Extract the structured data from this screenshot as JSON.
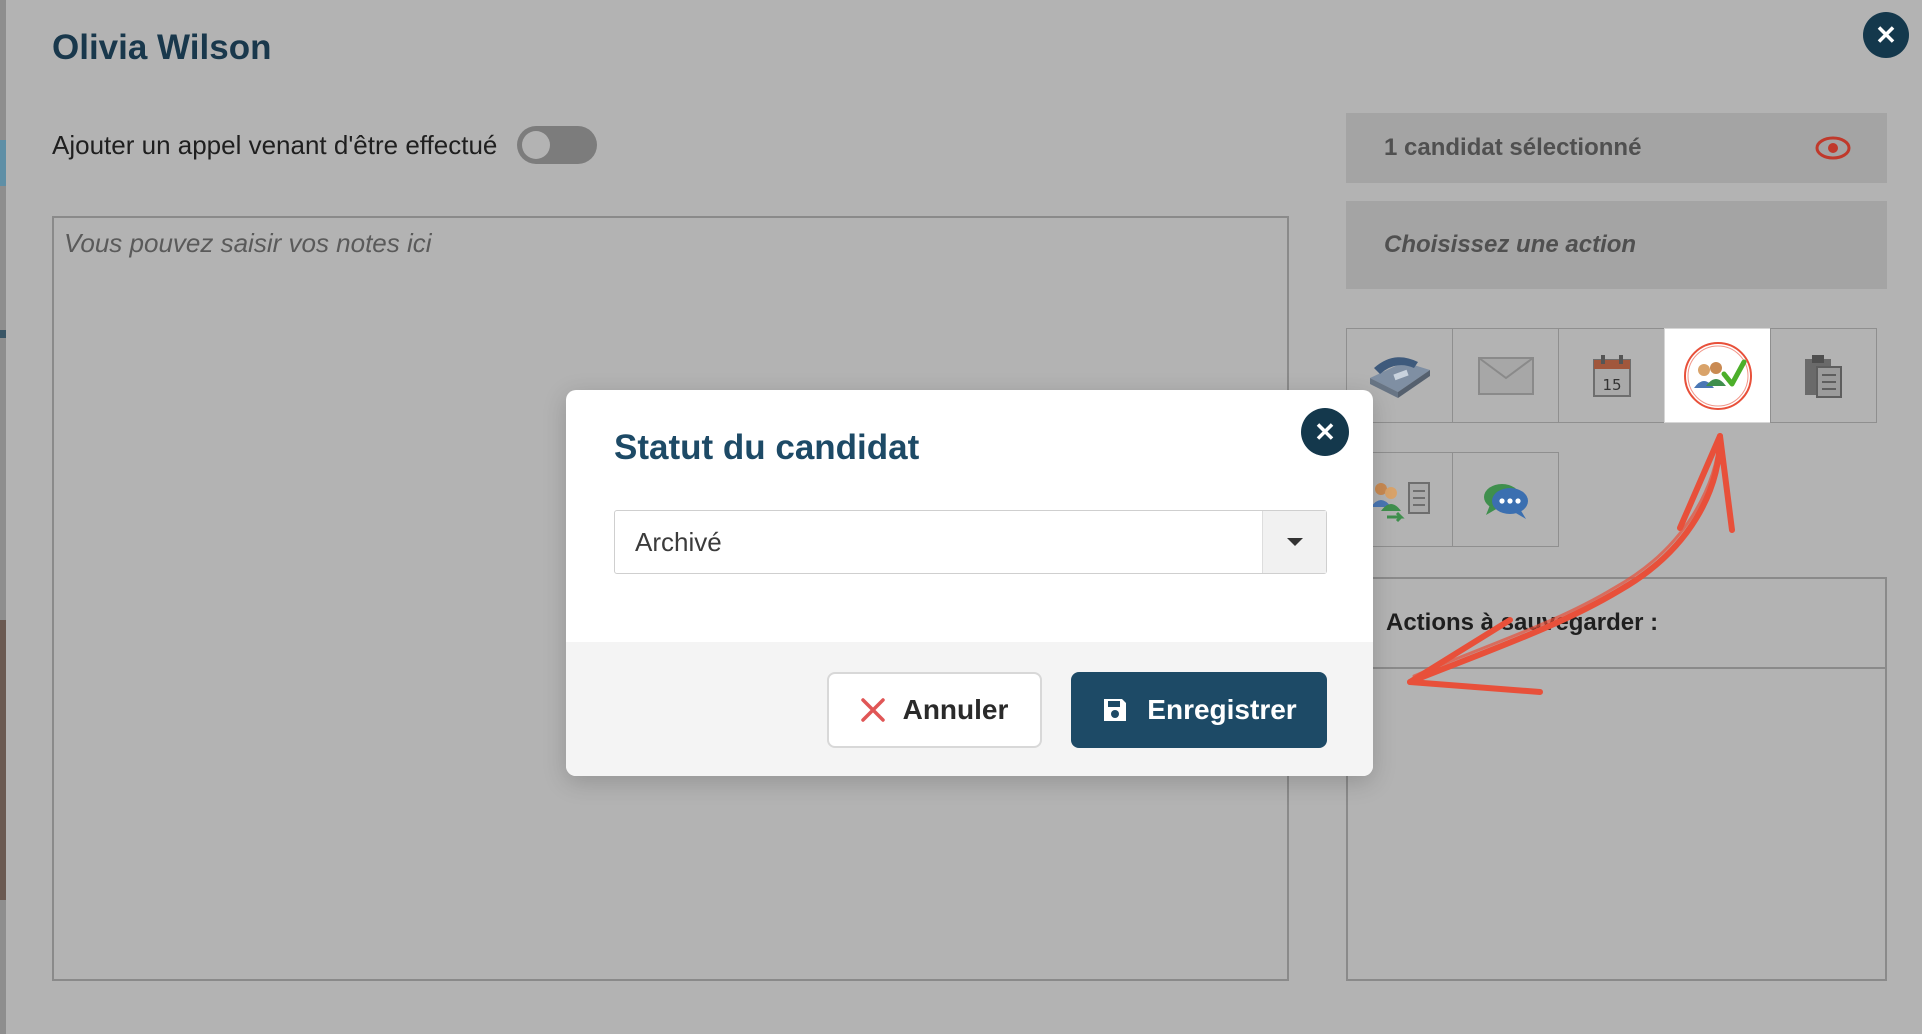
{
  "panel": {
    "title": "Olivia Wilson",
    "close_icon": "close-icon",
    "call_toggle_label": "Ajouter un appel venant d'être effectué",
    "call_toggle_on": false,
    "notes_placeholder": "Vous pouvez saisir vos notes ici",
    "notes_value": ""
  },
  "sidebar": {
    "selected_count_label": "1 candidat sélectionné",
    "eye_icon": "eye-icon",
    "action_placeholder": "Choisissez une action",
    "action_icons": [
      [
        "phone-icon",
        "envelope-icon",
        "calendar-icon",
        "candidate-status-icon",
        "clipboard-icon"
      ],
      [
        "candidates-transfer-icon",
        "chat-bubble-icon"
      ]
    ],
    "calendar_day": "15",
    "active_icon": "candidate-status-icon",
    "actions_to_save_label": "Actions à sauvegarder :"
  },
  "modal": {
    "title": "Statut du candidat",
    "status_selected": "Archivé",
    "cancel_label": "Annuler",
    "save_label": "Enregistrer"
  },
  "colors": {
    "primary": "#1d4a66",
    "dark_navy": "#14384c",
    "annotation_red": "#e8503a",
    "cancel_x": "#e05656",
    "eye_red": "#c0392b"
  }
}
